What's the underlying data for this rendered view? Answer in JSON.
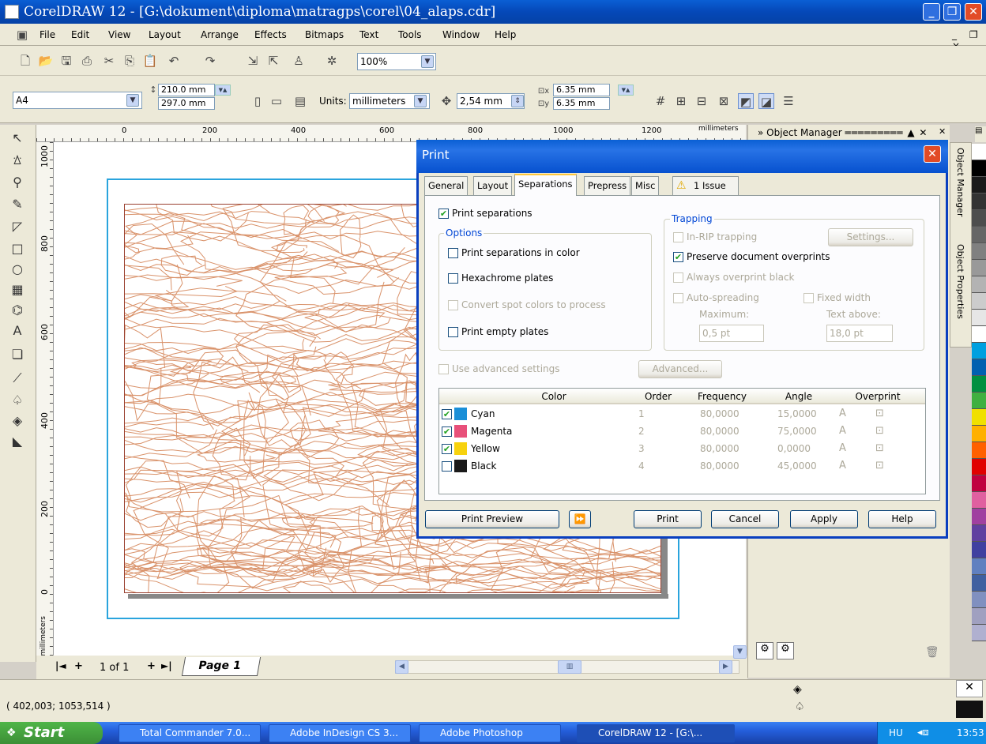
{
  "window": {
    "title": "CorelDRAW 12 - [G:\\dokument\\diploma\\matragps\\corel\\04_alaps.cdr]",
    "min_label": "_",
    "max_label": "❐",
    "close_label": "✕",
    "doc_controls": "_ ❐ ×"
  },
  "menu": [
    "File",
    "Edit",
    "View",
    "Layout",
    "Arrange",
    "Effects",
    "Bitmaps",
    "Text",
    "Tools",
    "Window",
    "Help"
  ],
  "toolbar": {
    "zoom": "100%",
    "paper": "A4",
    "width": "210.0 mm",
    "height": "297.0 mm",
    "units_label": "Units:",
    "units": "millimeters",
    "nudge": "2,54 mm",
    "dup_x": "6.35 mm",
    "dup_y": "6.35 mm"
  },
  "ruler": {
    "h_ticks": [
      "0",
      "200",
      "400",
      "600",
      "800",
      "1000",
      "1200"
    ],
    "h_unit": "millimeters",
    "v_ticks": [
      "1000",
      "800",
      "600",
      "400",
      "200",
      "0"
    ],
    "v_unit": "millimeters"
  },
  "page_tabs": {
    "first": "|◄",
    "add_before": "+",
    "position": "1 of 1",
    "add_after": "+",
    "last": "►|",
    "page_name": "Page 1"
  },
  "status": {
    "coords": "( 402,003; 1053,514 )"
  },
  "docker": {
    "title": "Object Manager",
    "tab1": "Object Manager",
    "tab2": "Object Properties"
  },
  "dialog": {
    "title": "Print",
    "tabs": [
      "General",
      "Layout",
      "Separations",
      "Prepress",
      "Misc",
      "1 Issue"
    ],
    "selected_tab": "Separations",
    "print_separations": "Print separations",
    "options_group": "Options",
    "opt_color": "Print separations in color",
    "opt_hexachrome": "Hexachrome plates",
    "opt_spot": "Convert spot colors to process",
    "opt_empty": "Print empty plates",
    "trapping_group": "Trapping",
    "in_rip": "In-RIP trapping",
    "settings_btn": "Settings...",
    "preserve": "Preserve document overprints",
    "always_black": "Always overprint black",
    "auto_spread": "Auto-spreading",
    "maximum": "Maximum:",
    "maximum_val": "0,5 pt",
    "fixed_width": "Fixed width",
    "text_above": "Text above:",
    "text_above_val": "18,0 pt",
    "advanced_settings": "Use advanced settings",
    "advanced_btn": "Advanced...",
    "columns": [
      "Color",
      "Order",
      "Frequency",
      "Angle",
      "Overprint"
    ],
    "rows": [
      {
        "name": "Cyan",
        "order": "1",
        "freq": "80,0000",
        "angle": "15,0000",
        "color": "#1a8fd8",
        "checked": true
      },
      {
        "name": "Magenta",
        "order": "2",
        "freq": "80,0000",
        "angle": "75,0000",
        "color": "#e8507a",
        "checked": true
      },
      {
        "name": "Yellow",
        "order": "3",
        "freq": "80,0000",
        "angle": "0,0000",
        "color": "#f7d20e",
        "checked": true
      },
      {
        "name": "Black",
        "order": "4",
        "freq": "80,0000",
        "angle": "45,0000",
        "color": "#1a1a1a",
        "checked": false
      }
    ],
    "btn_preview": "Print Preview",
    "btn_print": "Print",
    "btn_cancel": "Cancel",
    "btn_apply": "Apply",
    "btn_help": "Help"
  },
  "taskbar": {
    "start": "Start",
    "tasks": [
      "Total Commander 7.0...",
      "Adobe InDesign CS 3...",
      "Adobe Photoshop",
      "CorelDRAW 12 - [G:\\..."
    ],
    "lang": "HU",
    "clock": "13:53"
  },
  "colors": {
    "topo": "#d9926a",
    "accent": "#0a5fd4"
  }
}
